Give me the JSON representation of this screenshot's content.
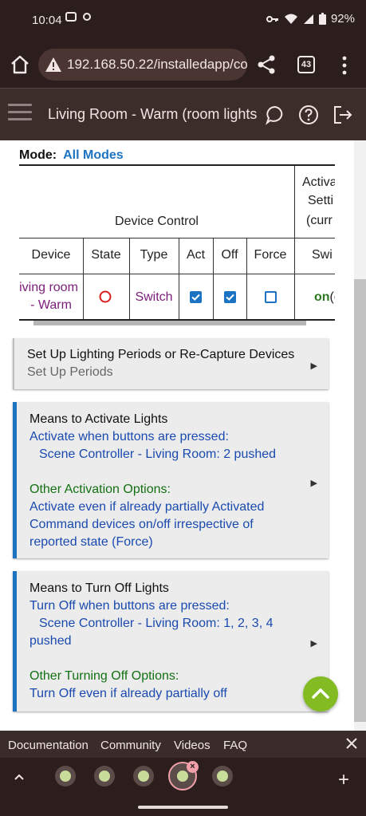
{
  "status_bar": {
    "time": "10:04",
    "battery": "92%",
    "icons": [
      "message-icon",
      "hotspot-icon",
      "key-icon",
      "wifi-icon",
      "signal-icon",
      "battery-icon"
    ]
  },
  "browser": {
    "url": "192.168.50.22/installedapp/co",
    "tab_count": "43"
  },
  "app_header": {
    "title": "Living Room - Warm (room lights)"
  },
  "mode": {
    "label": "Mode:",
    "value": "All Modes"
  },
  "table": {
    "group_header": "Device Control",
    "activation_header": [
      "Activa",
      "Setti",
      "(curr"
    ],
    "columns": [
      "Device",
      "State",
      "Type",
      "Act",
      "Off",
      "Force",
      "Swi"
    ],
    "row": {
      "device_line1": "iving room",
      "device_line2": "- Warm",
      "type": "Switch",
      "act_checked": true,
      "off_checked": true,
      "force_checked": false,
      "switch_on": "on",
      "switch_rest": "(c"
    }
  },
  "cards": {
    "setup": {
      "title": "Set Up Lighting Periods or Re-Capture Devices",
      "subtitle": "Set Up Periods"
    },
    "activate": {
      "title": "Means to Activate Lights",
      "line1": "Activate when buttons are pressed:",
      "line2": "Scene Controller - Living Room: 2 pushed",
      "other_title": "Other Activation Options:",
      "opt1": "Activate even if already partially Activated",
      "opt2": "Command devices on/off irrespective of",
      "opt3": "reported state (Force)"
    },
    "turnoff": {
      "title": "Means to Turn Off Lights",
      "line1": "Turn Off when buttons are pressed:",
      "line2": "Scene Controller - Living Room: 1, 2, 3, 4",
      "line3": "pushed",
      "other_title": "Other Turning Off Options:",
      "opt1": "Turn Off even if already partially off"
    }
  },
  "footer_links": [
    "Documentation",
    "Community",
    "Videos",
    "FAQ"
  ],
  "colors": {
    "accent_blue": "#1c73c1",
    "activate_green": "#82bc22",
    "browser_bg": "#2b1e1c"
  }
}
